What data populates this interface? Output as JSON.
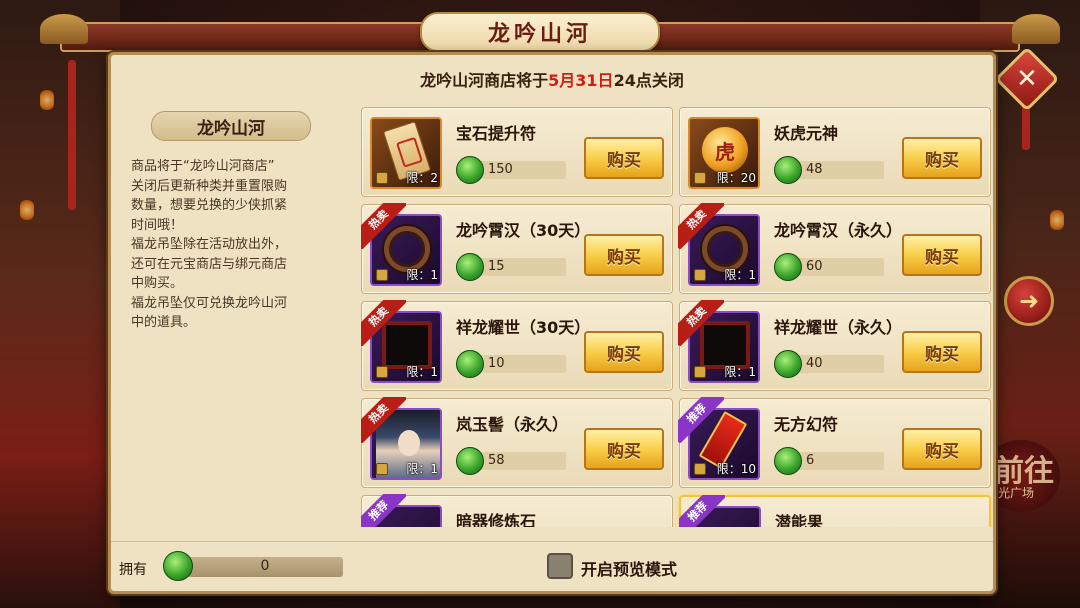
{
  "window": {
    "title": "龙吟山河",
    "close_icon": "✕"
  },
  "notice": {
    "prefix": "龙吟山河商店将于",
    "date": "5月31日",
    "suffix": "24点关闭"
  },
  "sidebar": {
    "title": "龙吟山河",
    "description": "商品将于“龙吟山河商店”\n关闭后更新种类并重置限购\n数量，想要兑换的少侠抓紧\n时间哦！\n福龙吊坠除在活动放出外，\n还可在元宝商店与绑元商店\n中购买。\n福龙吊坠仅可兑换龙吟山河\n中的道具。"
  },
  "shop": {
    "buy_label": "购买",
    "items": [
      {
        "name": "宝石提升符",
        "price": "150",
        "limit": "限：2",
        "tag": "",
        "icon": "scroll-icon"
      },
      {
        "name": "妖虎元神",
        "price": "48",
        "limit": "限：20",
        "tag": "",
        "icon": "tiger-orb-icon",
        "glyph": "虎"
      },
      {
        "name": "龙吟霄汉（30天）",
        "price": "15",
        "limit": "限：1",
        "tag": "热卖",
        "icon": "ring-frame-icon"
      },
      {
        "name": "龙吟霄汉（永久）",
        "price": "60",
        "limit": "限：1",
        "tag": "热卖",
        "icon": "ring-frame-icon"
      },
      {
        "name": "祥龙耀世（30天）",
        "price": "10",
        "limit": "限：1",
        "tag": "热卖",
        "icon": "portrait-frame-icon"
      },
      {
        "name": "祥龙耀世（永久）",
        "price": "40",
        "limit": "限：1",
        "tag": "热卖",
        "icon": "portrait-frame-icon"
      },
      {
        "name": "岚玉髻（永久）",
        "price": "58",
        "limit": "限：1",
        "tag": "热卖",
        "icon": "hairstyle-portrait-icon"
      },
      {
        "name": "无方幻符",
        "price": "6",
        "limit": "限：10",
        "tag": "推荐",
        "icon": "talisman-icon"
      },
      {
        "name": "暗器修炼石",
        "price": "",
        "limit": "",
        "tag": "推荐",
        "icon": "stone-icon"
      },
      {
        "name": "潜能果",
        "price": "",
        "limit": "",
        "tag": "推荐",
        "icon": "fruit-icon"
      }
    ]
  },
  "bottom": {
    "own_label": "拥有",
    "own_value": "0",
    "preview_label": "开启预览模式",
    "preview_checked": false
  },
  "right_badge": {
    "big": "前往",
    "small": "时光广场"
  },
  "colors": {
    "accent_red": "#d21e12",
    "button_gold": "#f8cf4a",
    "hot_ribbon": "#b81e16",
    "rec_ribbon": "#8a34c8",
    "currency_jade": "#3aa42a"
  }
}
